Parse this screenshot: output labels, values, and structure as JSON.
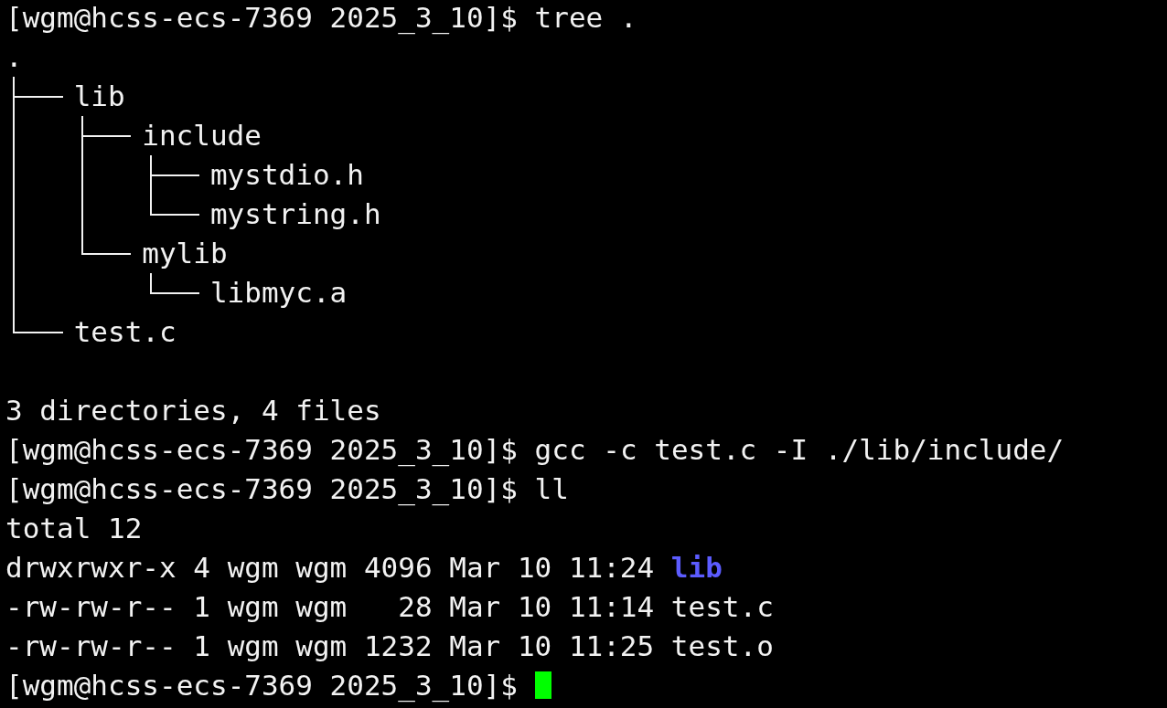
{
  "terminal": {
    "lines": [
      {
        "kind": "prompt",
        "prompt": "[wgm@hcss-ecs-7369 2025_3_10]$",
        "command": "tree ."
      },
      {
        "kind": "tree",
        "root": ".",
        "children": [
          {
            "name": "lib",
            "children": [
              {
                "name": "include",
                "children": [
                  {
                    "name": "mystdio.h"
                  },
                  {
                    "name": "mystring.h"
                  }
                ]
              },
              {
                "name": "mylib",
                "children": [
                  {
                    "name": "libmyc.a"
                  }
                ]
              }
            ]
          },
          {
            "name": "test.c"
          }
        ]
      },
      {
        "kind": "blank"
      },
      {
        "kind": "text",
        "text": "3 directories, 4 files"
      },
      {
        "kind": "prompt",
        "prompt": "[wgm@hcss-ecs-7369 2025_3_10]$",
        "command": "gcc -c test.c -I ./lib/include/"
      },
      {
        "kind": "prompt",
        "prompt": "[wgm@hcss-ecs-7369 2025_3_10]$",
        "command": "ll"
      },
      {
        "kind": "text",
        "text": "total 12"
      },
      {
        "kind": "listing",
        "info": "drwxrwxr-x 4 wgm wgm",
        "size": "4096",
        "date": "Mar 10 11:24",
        "name": "lib",
        "directory": true
      },
      {
        "kind": "listing",
        "info": "-rw-rw-r-- 1 wgm wgm",
        "size": "28",
        "date": "Mar 10 11:14",
        "name": "test.c",
        "directory": false
      },
      {
        "kind": "listing",
        "info": "-rw-rw-r-- 1 wgm wgm",
        "size": "1232",
        "date": "Mar 10 11:25",
        "name": "test.o",
        "directory": false
      },
      {
        "kind": "prompt",
        "prompt": "[wgm@hcss-ecs-7369 2025_3_10]$",
        "cursor": true
      }
    ]
  }
}
